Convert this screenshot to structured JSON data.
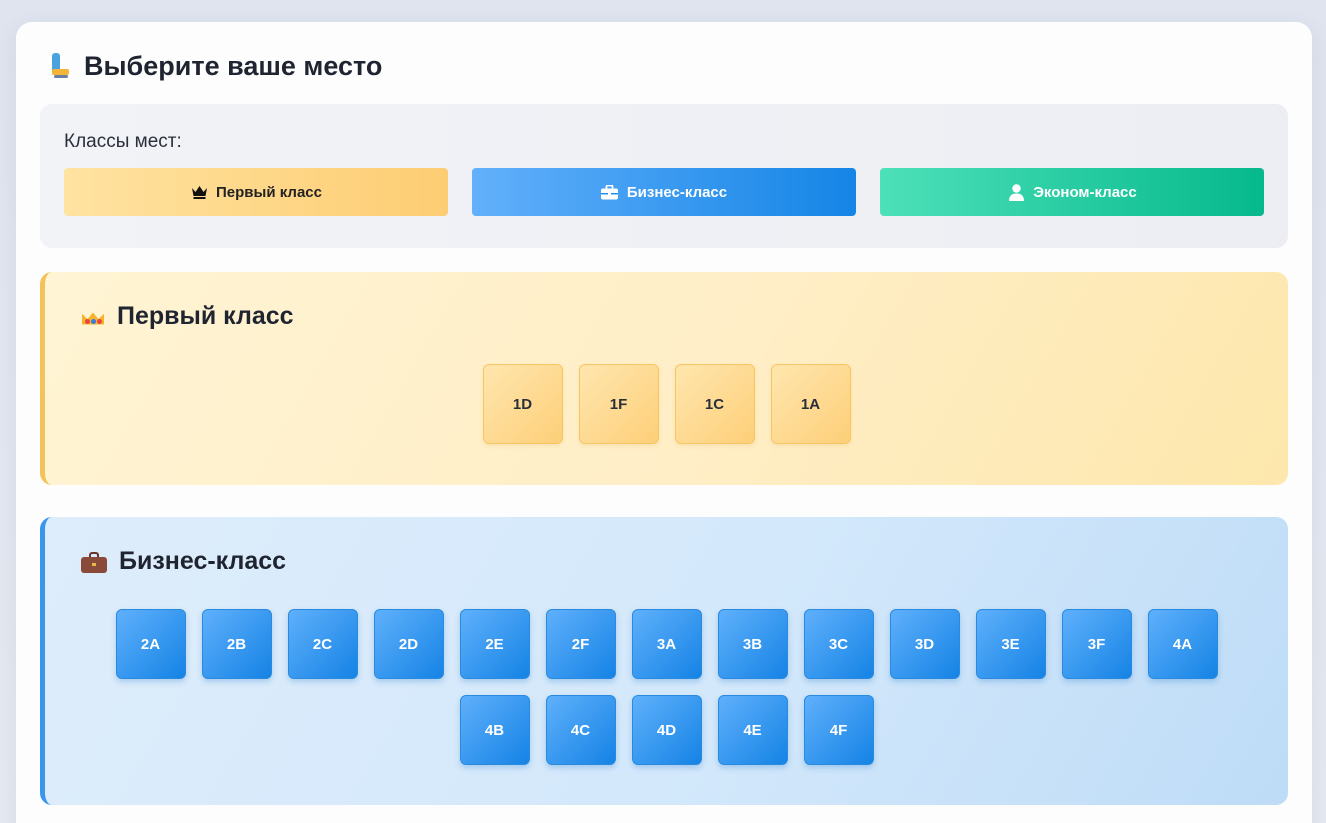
{
  "page": {
    "title": "Выберите ваше место",
    "title_icon": "seat-icon"
  },
  "classes_panel": {
    "label": "Классы мест:",
    "buttons": [
      {
        "label": "Первый класс",
        "icon": "crown-icon",
        "color": "#fdcd73"
      },
      {
        "label": "Бизнес-класс",
        "icon": "briefcase-icon",
        "color": "#1585e6"
      },
      {
        "label": "Эконом-класс",
        "icon": "user-icon",
        "color": "#05b98c"
      }
    ]
  },
  "sections": {
    "first": {
      "title": "Первый класс",
      "icon": "crown-emoji-icon",
      "seats": [
        "1D",
        "1F",
        "1C",
        "1A"
      ]
    },
    "business": {
      "title": "Бизнес-класс",
      "icon": "briefcase-emoji-icon",
      "seats_row1": [
        "2A",
        "2B",
        "2C",
        "2D",
        "2E",
        "2F",
        "3A",
        "3B",
        "3C",
        "3D",
        "3E",
        "3F",
        "4A"
      ],
      "seats_row2": [
        "4B",
        "4C",
        "4D",
        "4E",
        "4F"
      ]
    }
  }
}
